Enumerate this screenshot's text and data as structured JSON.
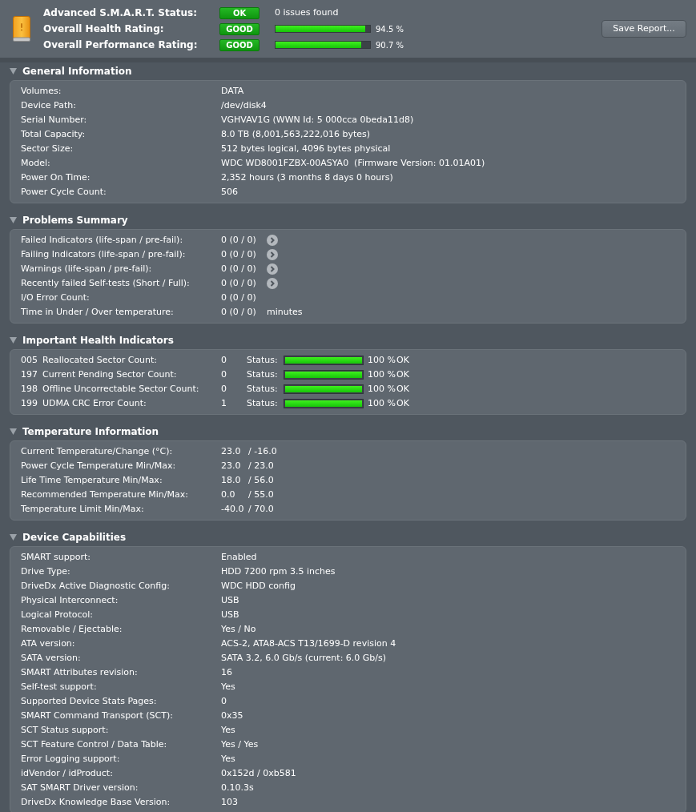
{
  "header": {
    "rows": [
      {
        "label": "Advanced S.M.A.R.T. Status:",
        "badge": "OK",
        "kind": "note",
        "note": "0 issues found"
      },
      {
        "label": "Overall Health Rating:",
        "badge": "GOOD",
        "kind": "meter",
        "level": 0.945,
        "reading": "94.5 %"
      },
      {
        "label": "Overall Performance Rating:",
        "badge": "GOOD",
        "kind": "meter",
        "level": 0.907,
        "reading": "90.7 %"
      }
    ],
    "save_button": "Save Report..."
  },
  "sections": [
    {
      "title": "General Information",
      "expanded": true,
      "kind": "info",
      "rows": [
        {
          "label": "Volumes:",
          "value": "DATA"
        },
        {
          "label": "Device Path:",
          "value": "/dev/disk4"
        },
        {
          "label": "Serial Number:",
          "value": "VGHVAV1G (WWN Id: 5 000cca 0beda11d8)"
        },
        {
          "label": "Total Capacity:",
          "value": "8.0 TB (8,001,563,222,016 bytes)"
        },
        {
          "label": "Sector Size:",
          "value": "512 bytes logical, 4096 bytes physical"
        },
        {
          "label": "Model:",
          "value": "WDC WD8001FZBX-00ASYA0  (Firmware Version: 01.01A01)"
        },
        {
          "label": "Power On Time:",
          "value": "2,352 hours (3 months 8 days 0 hours)"
        },
        {
          "label": "Power Cycle Count:",
          "value": "506"
        }
      ]
    },
    {
      "title": "Problems Summary",
      "expanded": true,
      "kind": "problems",
      "rows": [
        {
          "label": "Failed Indicators (life-span / pre-fail):",
          "value": "0 (0 / 0)",
          "detail_button": true
        },
        {
          "label": "Failing Indicators (life-span / pre-fail):",
          "value": "0 (0 / 0)",
          "detail_button": true
        },
        {
          "label": "Warnings (life-span / pre-fail):",
          "value": "0 (0 / 0)",
          "detail_button": true
        },
        {
          "label": "Recently failed Self-tests (Short / Full):",
          "value": "0 (0 / 0)",
          "detail_button": true
        },
        {
          "label": "I/O Error Count:",
          "value": "0 (0 / 0)",
          "detail_button": false
        },
        {
          "label": "Time in Under / Over temperature:",
          "value": "0 (0 / 0)",
          "detail_button": false,
          "unit": "minutes"
        }
      ]
    },
    {
      "title": "Important Health Indicators",
      "expanded": true,
      "kind": "indicators",
      "rows": [
        {
          "id": "005",
          "name": "Reallocated Sector Count:",
          "value": "0",
          "status_label": "Status:",
          "level": 1,
          "reading": "100 %",
          "result": "OK"
        },
        {
          "id": "197",
          "name": "Current Pending Sector Count:",
          "value": "0",
          "status_label": "Status:",
          "level": 1,
          "reading": "100 %",
          "result": "OK"
        },
        {
          "id": "198",
          "name": "Offline Uncorrectable Sector Count:",
          "value": "0",
          "status_label": "Status:",
          "level": 1,
          "reading": "100 %",
          "result": "OK"
        },
        {
          "id": "199",
          "name": "UDMA CRC Error Count:",
          "value": "1",
          "status_label": "Status:",
          "level": 1,
          "reading": "100 %",
          "result": "OK"
        }
      ]
    },
    {
      "title": "Temperature Information",
      "expanded": true,
      "kind": "temperature",
      "rows": [
        {
          "label": "Current Temperature/Change (°C):",
          "min": "23.0",
          "max": "/ -16.0"
        },
        {
          "label": "Power Cycle Temperature Min/Max:",
          "min": "23.0",
          "max": "/ 23.0"
        },
        {
          "label": "Life Time Temperature Min/Max:",
          "min": "18.0",
          "max": "/ 56.0"
        },
        {
          "label": "Recommended Temperature Min/Max:",
          "min": "0.0",
          "max": "/ 55.0"
        },
        {
          "label": "Temperature Limit Min/Max:",
          "min": "-40.0",
          "max": "/ 70.0"
        }
      ]
    },
    {
      "title": "Device Capabilities",
      "expanded": true,
      "kind": "info",
      "rows": [
        {
          "label": "SMART support:",
          "value": "Enabled"
        },
        {
          "label": "Drive Type:",
          "value": "HDD 7200 rpm 3.5 inches"
        },
        {
          "label": "DriveDx Active Diagnostic Config:",
          "value": "WDC HDD config"
        },
        {
          "label": "Physical Interconnect:",
          "value": "USB"
        },
        {
          "label": "Logical Protocol:",
          "value": "USB"
        },
        {
          "label": "Removable / Ejectable:",
          "value": "Yes / No"
        },
        {
          "label": "ATA version:",
          "value": "ACS-2, ATA8-ACS T13/1699-D revision 4"
        },
        {
          "label": "SATA version:",
          "value": "SATA 3.2, 6.0 Gb/s (current: 6.0 Gb/s)"
        },
        {
          "label": "SMART Attributes revision:",
          "value": "16"
        },
        {
          "label": "Self-test support:",
          "value": "Yes"
        },
        {
          "label": "Supported Device Stats Pages:",
          "value": "0"
        },
        {
          "label": "SMART Command Transport (SCT):",
          "value": "0x35"
        },
        {
          "label": "SCT Status support:",
          "value": "Yes"
        },
        {
          "label": "SCT Feature Control / Data Table:",
          "value": "Yes / Yes"
        },
        {
          "label": "Error Logging support:",
          "value": "Yes"
        },
        {
          "label": "idVendor / idProduct:",
          "value": "0x152d / 0xb581"
        },
        {
          "label": "SAT SMART Driver version:",
          "value": "0.10.3s"
        },
        {
          "label": "DriveDx Knowledge Base Version:",
          "value": "103"
        }
      ]
    }
  ]
}
